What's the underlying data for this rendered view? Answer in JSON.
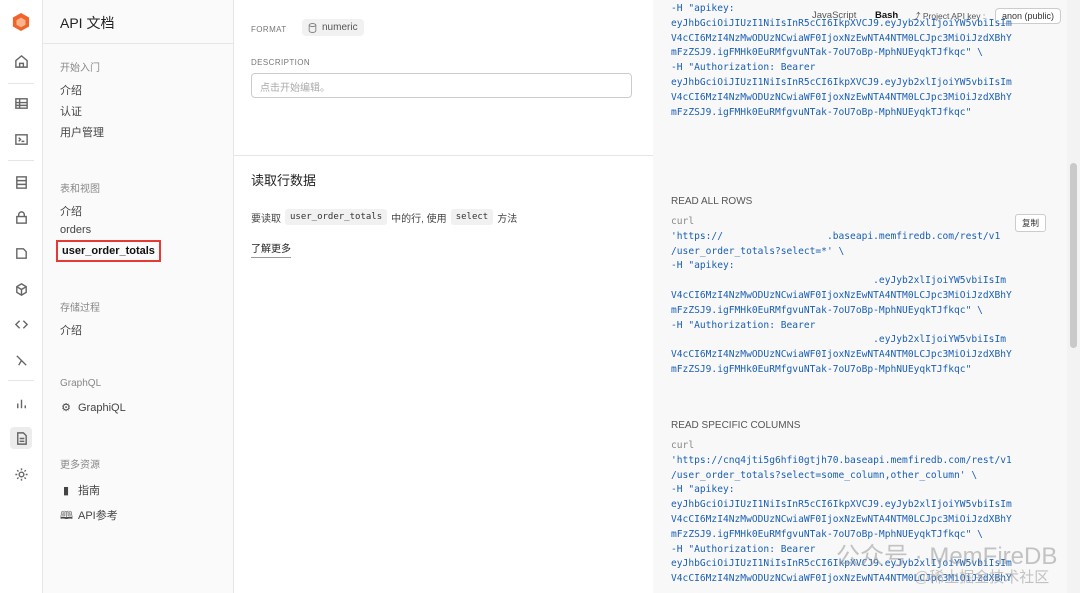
{
  "sidebar": {
    "title": "API 文档",
    "groups": [
      {
        "label": "开始入门",
        "items": [
          "介绍",
          "认证",
          "用户管理"
        ]
      },
      {
        "label": "表和视图",
        "items": [
          "介绍",
          "orders",
          "user_order_totals"
        ]
      },
      {
        "label": "存储过程",
        "items": [
          "介绍"
        ]
      },
      {
        "label": "GraphQL",
        "items": [
          "GraphiQL"
        ]
      },
      {
        "label": "更多资源",
        "items": [
          "指南",
          "API参考"
        ]
      }
    ]
  },
  "main": {
    "format_label": "FORMAT",
    "format_value": "numeric",
    "description_label": "DESCRIPTION",
    "description_placeholder": "点击开始编辑。",
    "section_title": "读取行数据",
    "sentence": {
      "part1": "要读取",
      "code1": "user_order_totals",
      "part2": "中的行, 使用",
      "code2": "select",
      "part3": "方法"
    },
    "learn_more": "了解更多"
  },
  "panel": {
    "tabs": [
      "JavaScript",
      "Bash"
    ],
    "active_tab": "Bash",
    "project_api_key_label": "Project API key :",
    "project_api_key_value": "anon (public)",
    "top_code": [
      "-H \"apikey:",
      "eyJhbGciOiJIUzI1NiIsInR5cCI6IkpXVCJ9.eyJyb2xlIjoiYW5vbiIsIm",
      "V4cCI6MzI4NzMwODUzNCwiaWF0IjoxNzEwNTA4NTM0LCJpc3MiOiJzdXBhY",
      "mFzZSJ9.igFMHk0EuRMfgvuNTak-7oU7oBp-MphNUEyqkTJfkqc\" \\",
      "-H \"Authorization: Bearer",
      "eyJhbGciOiJIUzI1NiIsInR5cCI6IkpXVCJ9.eyJyb2xlIjoiYW5vbiIsIm",
      "V4cCI6MzI4NzMwODUzNCwiaWF0IjoxNzEwNTA4NTM0LCJpc3MiOiJzdXBhY",
      "mFzZSJ9.igFMHk0EuRMfgvuNTak-7oU7oBp-MphNUEyqkTJfkqc\""
    ],
    "read_all_title": "READ ALL ROWS",
    "copy_label": "复制",
    "read_all_code": [
      "curl",
      "'https://                  .baseapi.memfiredb.com/rest/v1",
      "/user_order_totals?select=*' \\",
      "-H \"apikey:",
      "                                   .eyJyb2xlIjoiYW5vbiIsIm",
      "V4cCI6MzI4NzMwODUzNCwiaWF0IjoxNzEwNTA4NTM0LCJpc3MiOiJzdXBhY",
      "mFzZSJ9.igFMHk0EuRMfgvuNTak-7oU7oBp-MphNUEyqkTJfkqc\" \\",
      "-H \"Authorization: Bearer",
      "                                   .eyJyb2xlIjoiYW5vbiIsIm",
      "V4cCI6MzI4NzMwODUzNCwiaWF0IjoxNzEwNTA4NTM0LCJpc3MiOiJzdXBhY",
      "mFzZSJ9.igFMHk0EuRMfgvuNTak-7oU7oBp-MphNUEyqkTJfkqc\""
    ],
    "read_cols_title": "READ SPECIFIC COLUMNS",
    "read_cols_code": [
      "curl",
      "'https://cnq4jti5g6hfi0gtjh70.baseapi.memfiredb.com/rest/v1",
      "/user_order_totals?select=some_column,other_column' \\",
      "-H \"apikey:",
      "eyJhbGciOiJIUzI1NiIsInR5cCI6IkpXVCJ9.eyJyb2xlIjoiYW5vbiIsIm",
      "V4cCI6MzI4NzMwODUzNCwiaWF0IjoxNzEwNTA4NTM0LCJpc3MiOiJzdXBhY",
      "mFzZSJ9.igFMHk0EuRMfgvuNTak-7oU7oBp-MphNUEyqkTJfkqc\" \\",
      "-H \"Authorization: Bearer",
      "eyJhbGciOiJIUzI1NiIsInR5cCI6IkpXVCJ9.eyJyb2xlIjoiYW5vbiIsIm",
      "V4cCI6MzI4NzMwODUzNCwiaWF0IjoxNzEwNTA4NTM0LCJpc3MiOiJzdXBhY"
    ]
  },
  "watermark": {
    "line1": "公众号 · MemFireDB",
    "line2": "@稀土掘金技术社区"
  },
  "colors": {
    "code_blue": "#1a5fb4",
    "brand_orange": "#f0642c",
    "selection_red": "#e53935"
  },
  "rail_icons": [
    "home-icon",
    "table-icon",
    "terminal-icon",
    "database-icon",
    "lock-icon",
    "storage-icon",
    "cube-icon",
    "code-icon",
    "function-icon",
    "reports-icon",
    "docs-icon",
    "settings-icon"
  ]
}
